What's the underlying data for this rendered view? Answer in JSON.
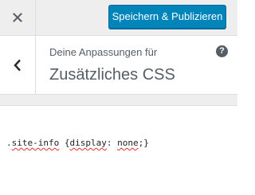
{
  "toolbar": {
    "close_icon": "close-icon",
    "publish_label": "Speichern & Publizieren"
  },
  "section": {
    "back_icon": "chevron-left-icon",
    "subtitle": "Deine Anpassungen für",
    "title": "Zusätzliches CSS",
    "help_icon": "help-icon",
    "help_glyph": "?"
  },
  "editor": {
    "code_parts": [
      ".",
      "site-info",
      " {",
      "display",
      ": ",
      "none",
      ";}"
    ]
  },
  "colors": {
    "accent": "#0085ba",
    "panel_bg": "#eeeeee",
    "text": "#555d66",
    "spellcheck": "#dc3232"
  }
}
